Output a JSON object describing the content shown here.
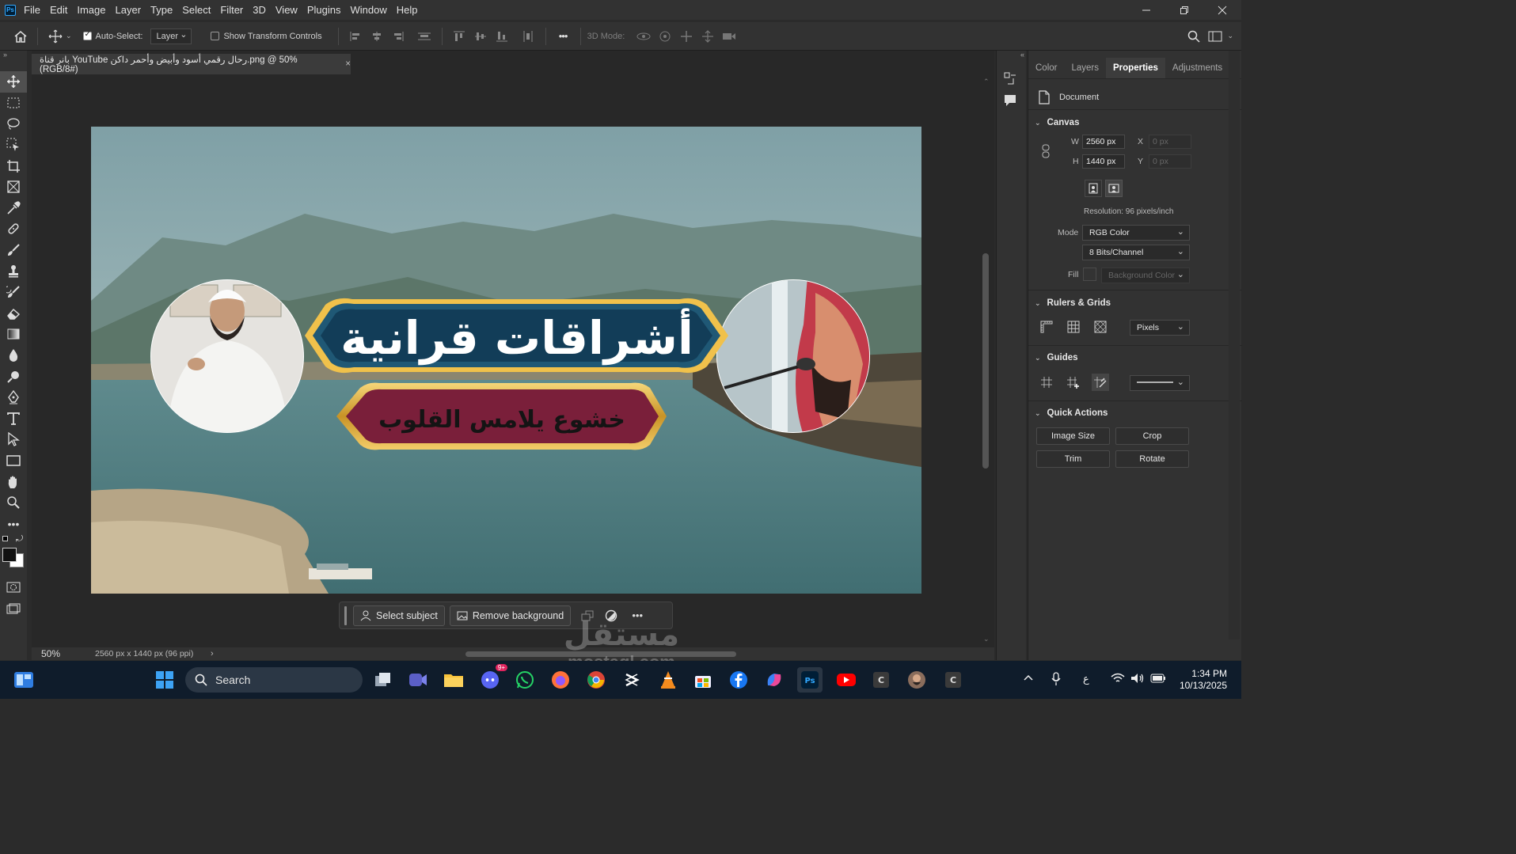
{
  "menu": [
    "File",
    "Edit",
    "Image",
    "Layer",
    "Type",
    "Select",
    "Filter",
    "3D",
    "View",
    "Plugins",
    "Window",
    "Help"
  ],
  "app_logo": "Ps",
  "options": {
    "auto_select_label": "Auto-Select:",
    "auto_select_target": "Layer",
    "show_transform_label": "Show Transform Controls",
    "mode_3d_label": "3D Mode:",
    "more_glyph": "•••"
  },
  "document": {
    "tab_title": "بانر قناة YouTube رحال رقمي أسود وأبيض وأحمر داكن.png @ 50% (RGB/8#)",
    "tab_close": "×",
    "banner_title": "أشراقات قرانية",
    "banner_subtitle": "خشوع يلامس القلوب"
  },
  "context_bar": {
    "select_subject": "Select subject",
    "remove_background": "Remove background",
    "more_glyph": "•••"
  },
  "status": {
    "zoom": "50%",
    "doc_info": "2560 px x 1440 px (96 ppi)",
    "arrow": "›"
  },
  "panel": {
    "tabs": [
      "Color",
      "Layers",
      "Properties",
      "Adjustments"
    ],
    "active_tab": "Properties",
    "document_label": "Document",
    "canvas": {
      "header": "Canvas",
      "w_label": "W",
      "w_value": "2560 px",
      "h_label": "H",
      "h_value": "1440 px",
      "x_label": "X",
      "x_value": "0 px",
      "y_label": "Y",
      "y_value": "0 px",
      "resolution": "Resolution: 96 pixels/inch",
      "mode_label": "Mode",
      "mode_value": "RGB Color",
      "bits_value": "8 Bits/Channel",
      "fill_label": "Fill",
      "fill_value": "Background Color"
    },
    "rulers": {
      "header": "Rulers & Grids",
      "unit": "Pixels"
    },
    "guides": {
      "header": "Guides"
    },
    "quick_actions": {
      "header": "Quick Actions",
      "buttons": [
        "Image Size",
        "Crop",
        "Trim",
        "Rotate"
      ]
    }
  },
  "taskbar": {
    "search_label": "Search",
    "time": "1:34 PM",
    "date": "10/13/2025",
    "discord_badge": "9+",
    "lang": "ع"
  },
  "watermark": {
    "line1": "مستقل",
    "line2": "mostaql.com"
  },
  "colors": {
    "accent": "#31a8ff",
    "panel_bg": "#323232",
    "canvas_bg": "#282828",
    "taskbar_bg": "#0f1c2b"
  }
}
